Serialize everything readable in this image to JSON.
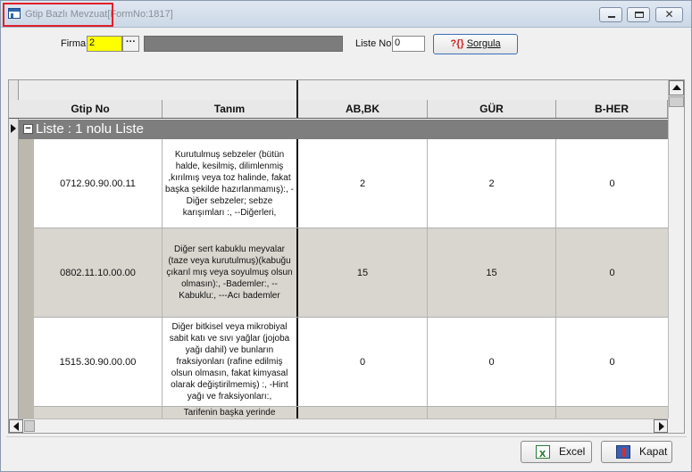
{
  "window": {
    "title": "Gtip Bazlı Mevzuat",
    "form_no": "[FormNo:1817]"
  },
  "toolbar": {
    "firma_label": "Firma",
    "firma_value": "2",
    "browse_label": "···",
    "liste_no_label": "Liste No",
    "liste_no_value": "0",
    "sorgula_label": "Sorgula"
  },
  "grid": {
    "columns": [
      "Gtip No",
      "Tanım",
      "AB,BK",
      "GÜR",
      "B-HER"
    ],
    "group_label": "Liste : 1 nolu Liste",
    "rows": [
      {
        "gtip_no": "0712.90.90.00.11",
        "tanim": "Kurutulmuş sebzeler (bütün halde, kesilmiş, dilimlenmiş ,kırılmış veya toz halinde, fakat başka şekilde hazırlanmamış):, -Diğer sebzeler; sebze karışımları :, --Diğerleri,",
        "ab_bk": "2",
        "gur": "2",
        "b_her": "0"
      },
      {
        "gtip_no": "0802.11.10.00.00",
        "tanim": "Diğer sert kabuklu meyvalar (taze veya kurutulmuş)(kabuğu çıkarıl mış veya soyulmuş olsun olmasın):, -Bademler:, --Kabuklu:, ---Acı bademler",
        "ab_bk": "15",
        "gur": "15",
        "b_her": "0"
      },
      {
        "gtip_no": "1515.30.90.00.00",
        "tanim": "Diğer bitkisel veya mikrobiyal sabit katı ve sıvı yağlar (jojoba yağı dahil) ve bunların fraksiyonları (rafine edilmiş olsun olmasın, fakat kimyasal olarak değiştirilmemiş) :, -Hint yağı ve fraksiyonları:,",
        "ab_bk": "0",
        "gur": "0",
        "b_her": "0"
      }
    ],
    "partial_row_text": "Tarifenin başka yerinde"
  },
  "footer": {
    "excel_label": "Excel",
    "kapat_label": "Kapat"
  }
}
